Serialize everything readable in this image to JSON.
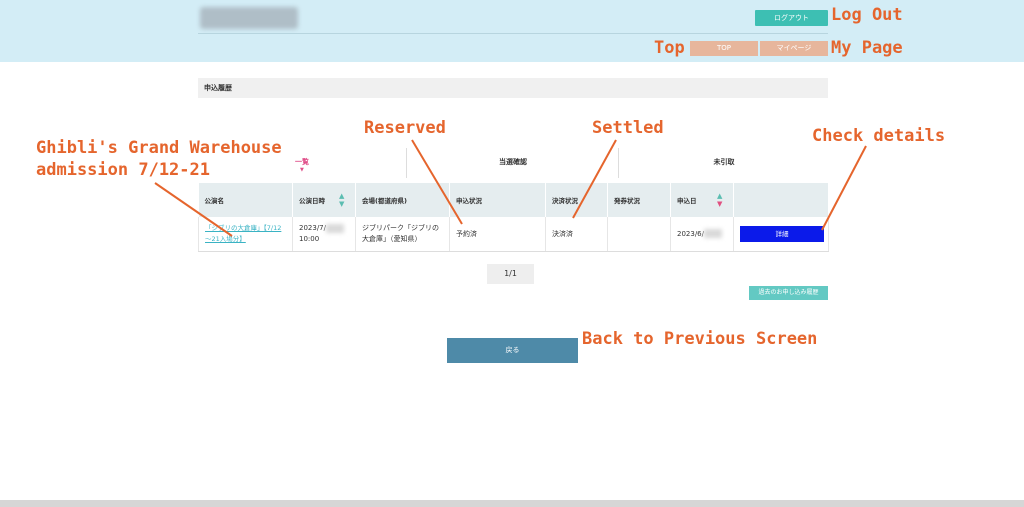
{
  "header": {
    "logout": "ログアウト",
    "top": "TOP",
    "mypage": "マイページ"
  },
  "section_title": "申込履歴",
  "tabs": [
    "一覧",
    "当選確認",
    "未引取"
  ],
  "table": {
    "headers": [
      "公演名",
      "公演日時",
      "会場(都道府県)",
      "申込状況",
      "決済状況",
      "発券状況",
      "申込日",
      ""
    ],
    "row": {
      "performance": "「ジブリの大倉庫」【7/12～21入場分】",
      "date_line1": "2023/7/",
      "date_line2": "10:00",
      "venue": "ジブリパーク「ジブリの大倉庫」（愛知県）",
      "application_status": "予約済",
      "payment_status": "決済済",
      "ticket_status": "",
      "applied_date": "2023/6/",
      "detail_button": "詳細"
    }
  },
  "pager": "1/1",
  "past_history_button": "過去のお申し込み履歴",
  "back_button": "戻る",
  "annotations": {
    "logout": "Log Out",
    "top": "Top",
    "mypage": "My Page",
    "ghibli_line1": "Ghibli's Grand Warehouse",
    "ghibli_line2": "admission 7/12-21",
    "reserved": "Reserved",
    "settled": "Settled",
    "check_details": "Check details",
    "back": "Back to Previous Screen"
  },
  "colors": {
    "header_bg": "#d3edf6",
    "logout_btn": "#3dbfb3",
    "nav_btn": "#e7b69c",
    "detail_btn": "#0b1aea",
    "back_btn": "#4e8aa8",
    "annotation": "#e5652d",
    "accent_pink": "#e0508a"
  }
}
